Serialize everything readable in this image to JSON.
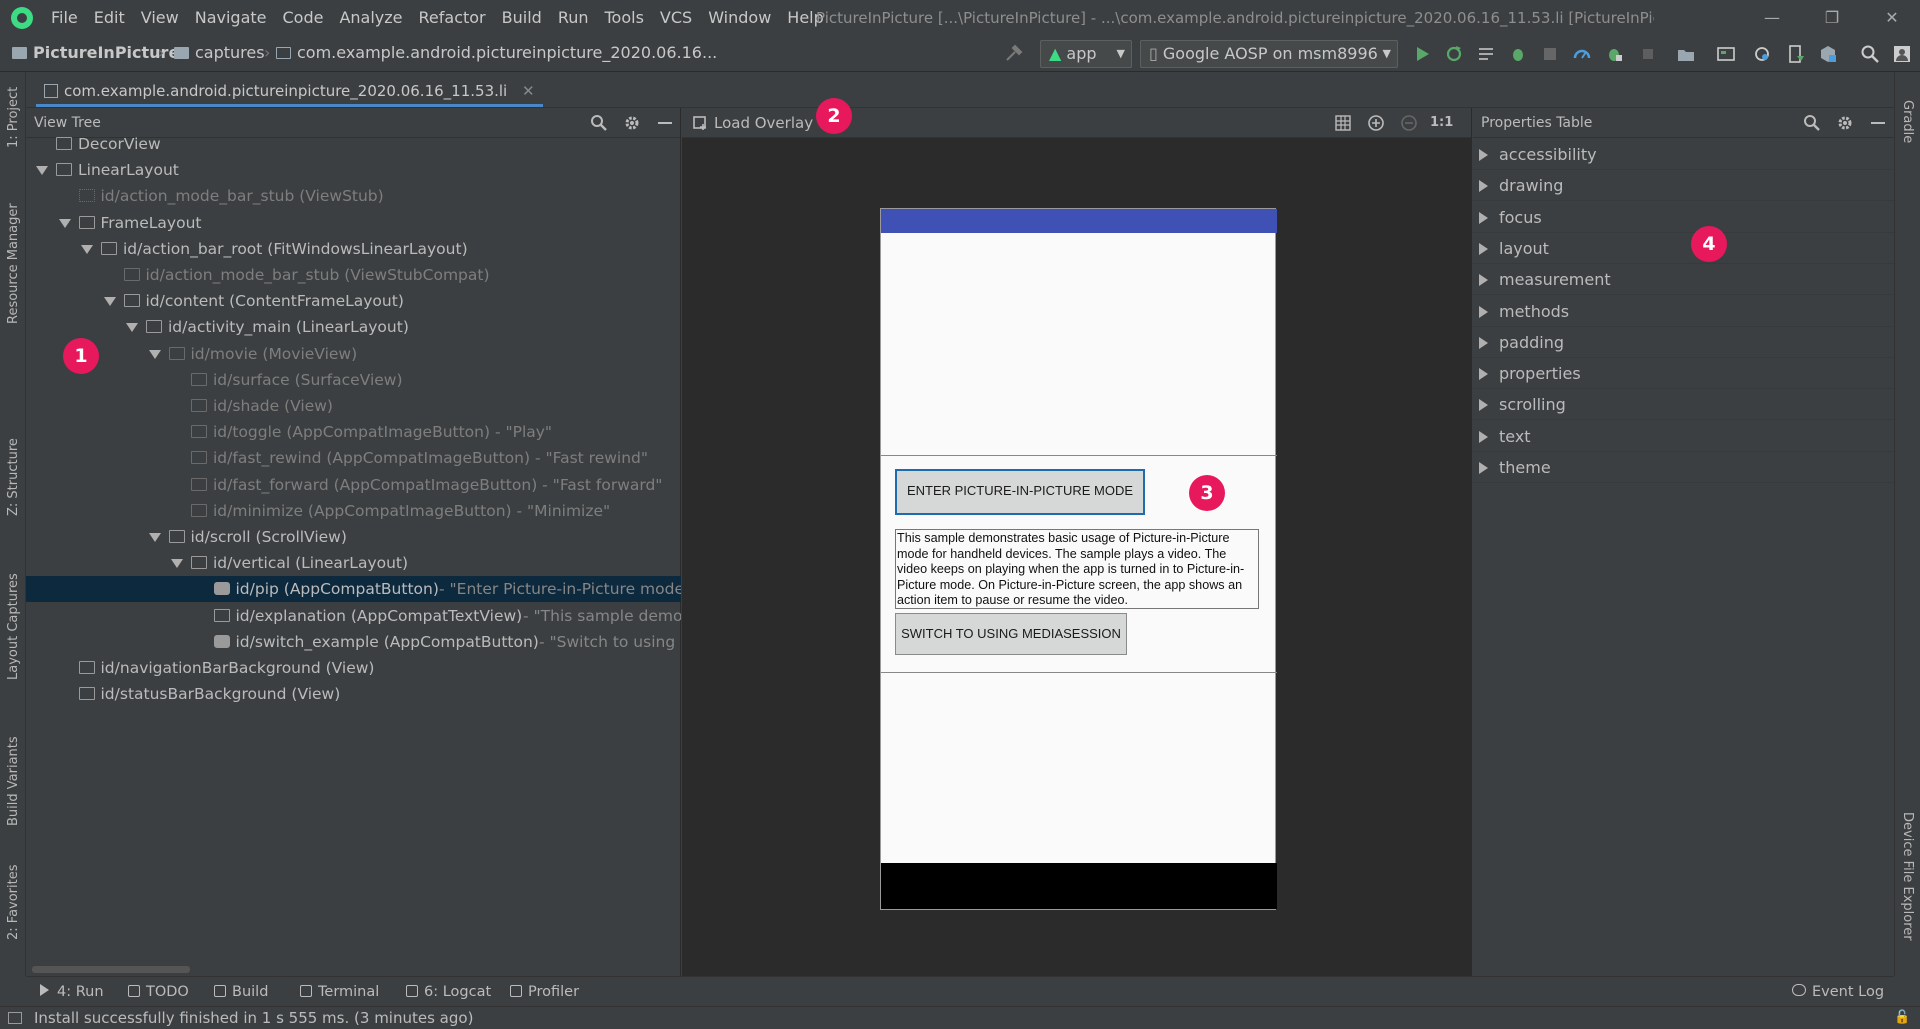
{
  "menu": [
    "File",
    "Edit",
    "View",
    "Navigate",
    "Code",
    "Analyze",
    "Refactor",
    "Build",
    "Run",
    "Tools",
    "VCS",
    "Window",
    "Help"
  ],
  "window_title": "PictureInPicture [...\\PictureInPicture] - ...\\com.example.android.pictureinpicture_2020.06.16_11.53.li [PictureInPicture]",
  "breadcrumb": {
    "project": "PictureInPicture",
    "folder": "captures",
    "file": "com.example.android.pictureinpicture_2020.06.16..."
  },
  "toolbar": {
    "run_config": "app",
    "device": "Google AOSP on msm8996"
  },
  "editor_tab": "com.example.android.pictureinpicture_2020.06.16_11.53.li",
  "left_strip": [
    "1: Project",
    "Resource Manager",
    "Z: Structure",
    "Layout Captures",
    "Build Variants",
    "2: Favorites"
  ],
  "right_strip": [
    "Gradle",
    "Device File Explorer"
  ],
  "view_tree": {
    "title": "View Tree",
    "rows": [
      {
        "indent": 0,
        "tri": false,
        "label": "DecorView",
        "suffix": "",
        "dim": false,
        "icon": "frame-icon"
      },
      {
        "indent": 0,
        "tri": true,
        "label": "LinearLayout",
        "suffix": "",
        "dim": false,
        "icon": "linear-layout-icon"
      },
      {
        "indent": 1,
        "tri": false,
        "label": "id/action_mode_bar_stub (ViewStub)",
        "suffix": "",
        "dim": true,
        "icon": "viewstub-icon"
      },
      {
        "indent": 1,
        "tri": true,
        "label": "FrameLayout",
        "suffix": "",
        "dim": false,
        "icon": "frame-layout-icon"
      },
      {
        "indent": 2,
        "tri": true,
        "label": "id/action_bar_root (FitWindowsLinearLayout)",
        "suffix": "",
        "dim": false,
        "icon": "linear-layout-icon"
      },
      {
        "indent": 3,
        "tri": false,
        "label": "id/action_mode_bar_stub (ViewStubCompat)",
        "suffix": "",
        "dim": true,
        "icon": "view-icon"
      },
      {
        "indent": 3,
        "tri": true,
        "label": "id/content (ContentFrameLayout)",
        "suffix": "",
        "dim": false,
        "icon": "frame-layout-icon"
      },
      {
        "indent": 4,
        "tri": true,
        "label": "id/activity_main (LinearLayout)",
        "suffix": "",
        "dim": false,
        "icon": "linear-layout-icon"
      },
      {
        "indent": 5,
        "tri": true,
        "label": "id/movie (MovieView)",
        "suffix": "",
        "dim": true,
        "icon": "view-icon"
      },
      {
        "indent": 6,
        "tri": false,
        "label": "id/surface (SurfaceView)",
        "suffix": "",
        "dim": true,
        "icon": "surface-icon"
      },
      {
        "indent": 6,
        "tri": false,
        "label": "id/shade (View)",
        "suffix": "",
        "dim": true,
        "icon": "view-icon"
      },
      {
        "indent": 6,
        "tri": false,
        "label": "id/toggle (AppCompatImageButton) - \"Play\"",
        "suffix": "",
        "dim": true,
        "icon": "image-icon"
      },
      {
        "indent": 6,
        "tri": false,
        "label": "id/fast_rewind (AppCompatImageButton) - \"Fast rewind\"",
        "suffix": "",
        "dim": true,
        "icon": "image-icon"
      },
      {
        "indent": 6,
        "tri": false,
        "label": "id/fast_forward (AppCompatImageButton) - \"Fast forward\"",
        "suffix": "",
        "dim": true,
        "icon": "image-icon"
      },
      {
        "indent": 6,
        "tri": false,
        "label": "id/minimize (AppCompatImageButton) - \"Minimize\"",
        "suffix": "",
        "dim": true,
        "icon": "image-icon"
      },
      {
        "indent": 5,
        "tri": true,
        "label": "id/scroll (ScrollView)",
        "suffix": "",
        "dim": false,
        "icon": "scroll-icon"
      },
      {
        "indent": 6,
        "tri": true,
        "label": "id/vertical (LinearLayout)",
        "suffix": "",
        "dim": false,
        "icon": "linear-layout-icon"
      },
      {
        "indent": 7,
        "tri": false,
        "label": "id/pip (AppCompatButton)",
        "suffix": " - \"Enter Picture-in-Picture mode\"",
        "dim": false,
        "icon": "button-icon",
        "selected": true
      },
      {
        "indent": 7,
        "tri": false,
        "label": "id/explanation (AppCompatTextView)",
        "suffix": " - \"This sample demons",
        "dim": false,
        "icon": "text-icon"
      },
      {
        "indent": 7,
        "tri": false,
        "label": "id/switch_example (AppCompatButton)",
        "suffix": " - \"Switch to using Me",
        "dim": false,
        "icon": "button-icon"
      },
      {
        "indent": 1,
        "tri": false,
        "label": "id/navigationBarBackground (View)",
        "suffix": "",
        "dim": false,
        "icon": "view-icon"
      },
      {
        "indent": 1,
        "tri": false,
        "label": "id/statusBarBackground (View)",
        "suffix": "",
        "dim": false,
        "icon": "view-icon"
      }
    ]
  },
  "center": {
    "load_overlay": "Load Overlay",
    "zoom_label": "1:1",
    "device": {
      "pip_button": "ENTER PICTURE-IN-PICTURE MODE",
      "explanation": "This sample demonstrates basic usage of Picture-in-Picture mode for handheld devices. The sample plays a video. The video keeps on playing when the app is turned in to Picture-in-Picture mode. On Picture-in-Picture screen, the app shows an action item to pause or resume the video.",
      "switch_button": "SWITCH TO USING MEDIASESSION"
    }
  },
  "properties": {
    "title": "Properties Table",
    "groups": [
      "accessibility",
      "drawing",
      "focus",
      "layout",
      "measurement",
      "methods",
      "padding",
      "properties",
      "scrolling",
      "text",
      "theme"
    ]
  },
  "badges": [
    "1",
    "2",
    "3",
    "4"
  ],
  "bottom_tools": [
    {
      "label": "4: Run",
      "icon": "run-icon"
    },
    {
      "label": "TODO",
      "icon": "todo-icon"
    },
    {
      "label": "Build",
      "icon": "build-icon"
    },
    {
      "label": "Terminal",
      "icon": "terminal-icon"
    },
    {
      "label": "6: Logcat",
      "icon": "logcat-icon"
    },
    {
      "label": "Profiler",
      "icon": "profiler-icon"
    }
  ],
  "event_log": "Event Log",
  "status": "Install successfully finished in 1 s 555 ms. (3 minutes ago)",
  "colors": {
    "accent": "#4a88c7",
    "badge": "#e8185d",
    "selection": "#0d293e",
    "device_toolbar": "#3f51b5"
  }
}
